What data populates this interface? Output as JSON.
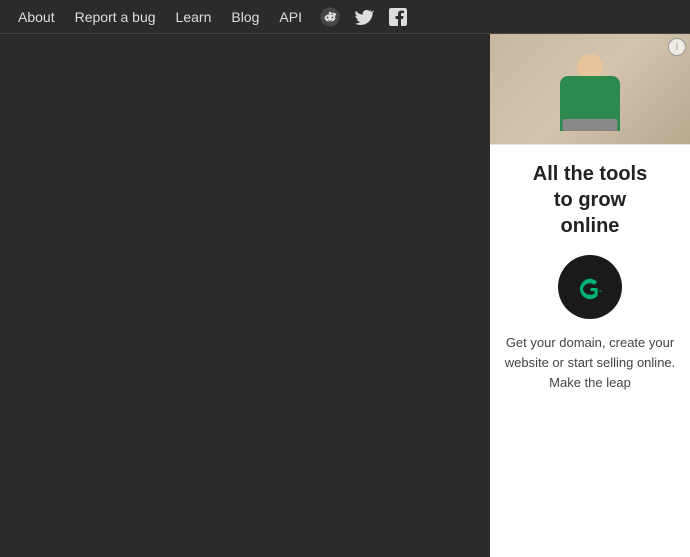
{
  "navbar": {
    "links": [
      {
        "id": "about",
        "label": "About"
      },
      {
        "id": "report-bug",
        "label": "Report a bug"
      },
      {
        "id": "learn",
        "label": "Learn"
      },
      {
        "id": "blog",
        "label": "Blog"
      },
      {
        "id": "api",
        "label": "API"
      }
    ],
    "icons": [
      {
        "id": "reddit",
        "symbol": "reddit-icon"
      },
      {
        "id": "twitter",
        "symbol": "twitter-icon"
      },
      {
        "id": "facebook",
        "symbol": "facebook-icon"
      }
    ]
  },
  "ad": {
    "headline_line1": "All the tools",
    "headline_line2": "to grow",
    "headline_line3": "online",
    "body_text": "Get your domain, create your website or start selling online. Make the leap",
    "info_label": "i"
  }
}
